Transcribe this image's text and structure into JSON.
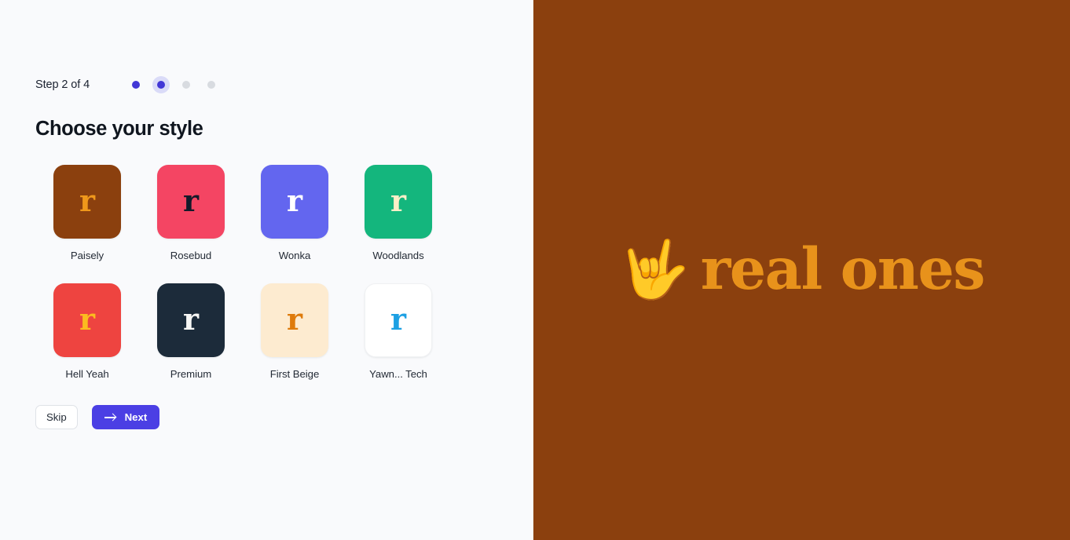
{
  "wizard": {
    "step_label": "Step 2 of 4",
    "current_step": 2,
    "total_steps": 4,
    "dots": [
      {
        "state": "done"
      },
      {
        "state": "current"
      },
      {
        "state": "upcoming"
      },
      {
        "state": "upcoming"
      }
    ],
    "heading": "Choose your style"
  },
  "styles": [
    {
      "name": "Paisely",
      "bg": "#8B400E",
      "glyph": "r",
      "glyph_color": "#F0981B",
      "bordered": false
    },
    {
      "name": "Rosebud",
      "bg": "#F44563",
      "glyph": "r",
      "glyph_color": "#131A2A",
      "bordered": false
    },
    {
      "name": "Wonka",
      "bg": "#6366EF",
      "glyph": "r",
      "glyph_color": "#FFFFFF",
      "bordered": false
    },
    {
      "name": "Woodlands",
      "bg": "#14B67D",
      "glyph": "r",
      "glyph_color": "#FBEFC8",
      "bordered": false
    },
    {
      "name": "Hell Yeah",
      "bg": "#EE4440",
      "glyph": "r",
      "glyph_color": "#FBBB1F",
      "bordered": false
    },
    {
      "name": "Premium",
      "bg": "#1C2B3A",
      "glyph": "r",
      "glyph_color": "#F7F7F5",
      "bordered": false
    },
    {
      "name": "First Beige",
      "bg": "#FDEBD0",
      "glyph": "r",
      "glyph_color": "#DE7B0C",
      "bordered": false
    },
    {
      "name": "Yawn... Tech",
      "bg": "#FFFFFF",
      "glyph": "r",
      "glyph_color": "#1CA0E3",
      "bordered": true
    }
  ],
  "actions": {
    "skip_label": "Skip",
    "next_label": "Next",
    "next_icon": "arrow-right-icon"
  },
  "brand": {
    "emoji": "🤟",
    "emoji_name": "love-you-hand-sign",
    "wordmark": "real ones",
    "wordmark_color": "#E8921B",
    "panel_color": "#8B400E"
  },
  "theme": {
    "accent": "#4B3FE4",
    "left_bg": "#F9FAFC",
    "heading_color": "#10161F"
  }
}
